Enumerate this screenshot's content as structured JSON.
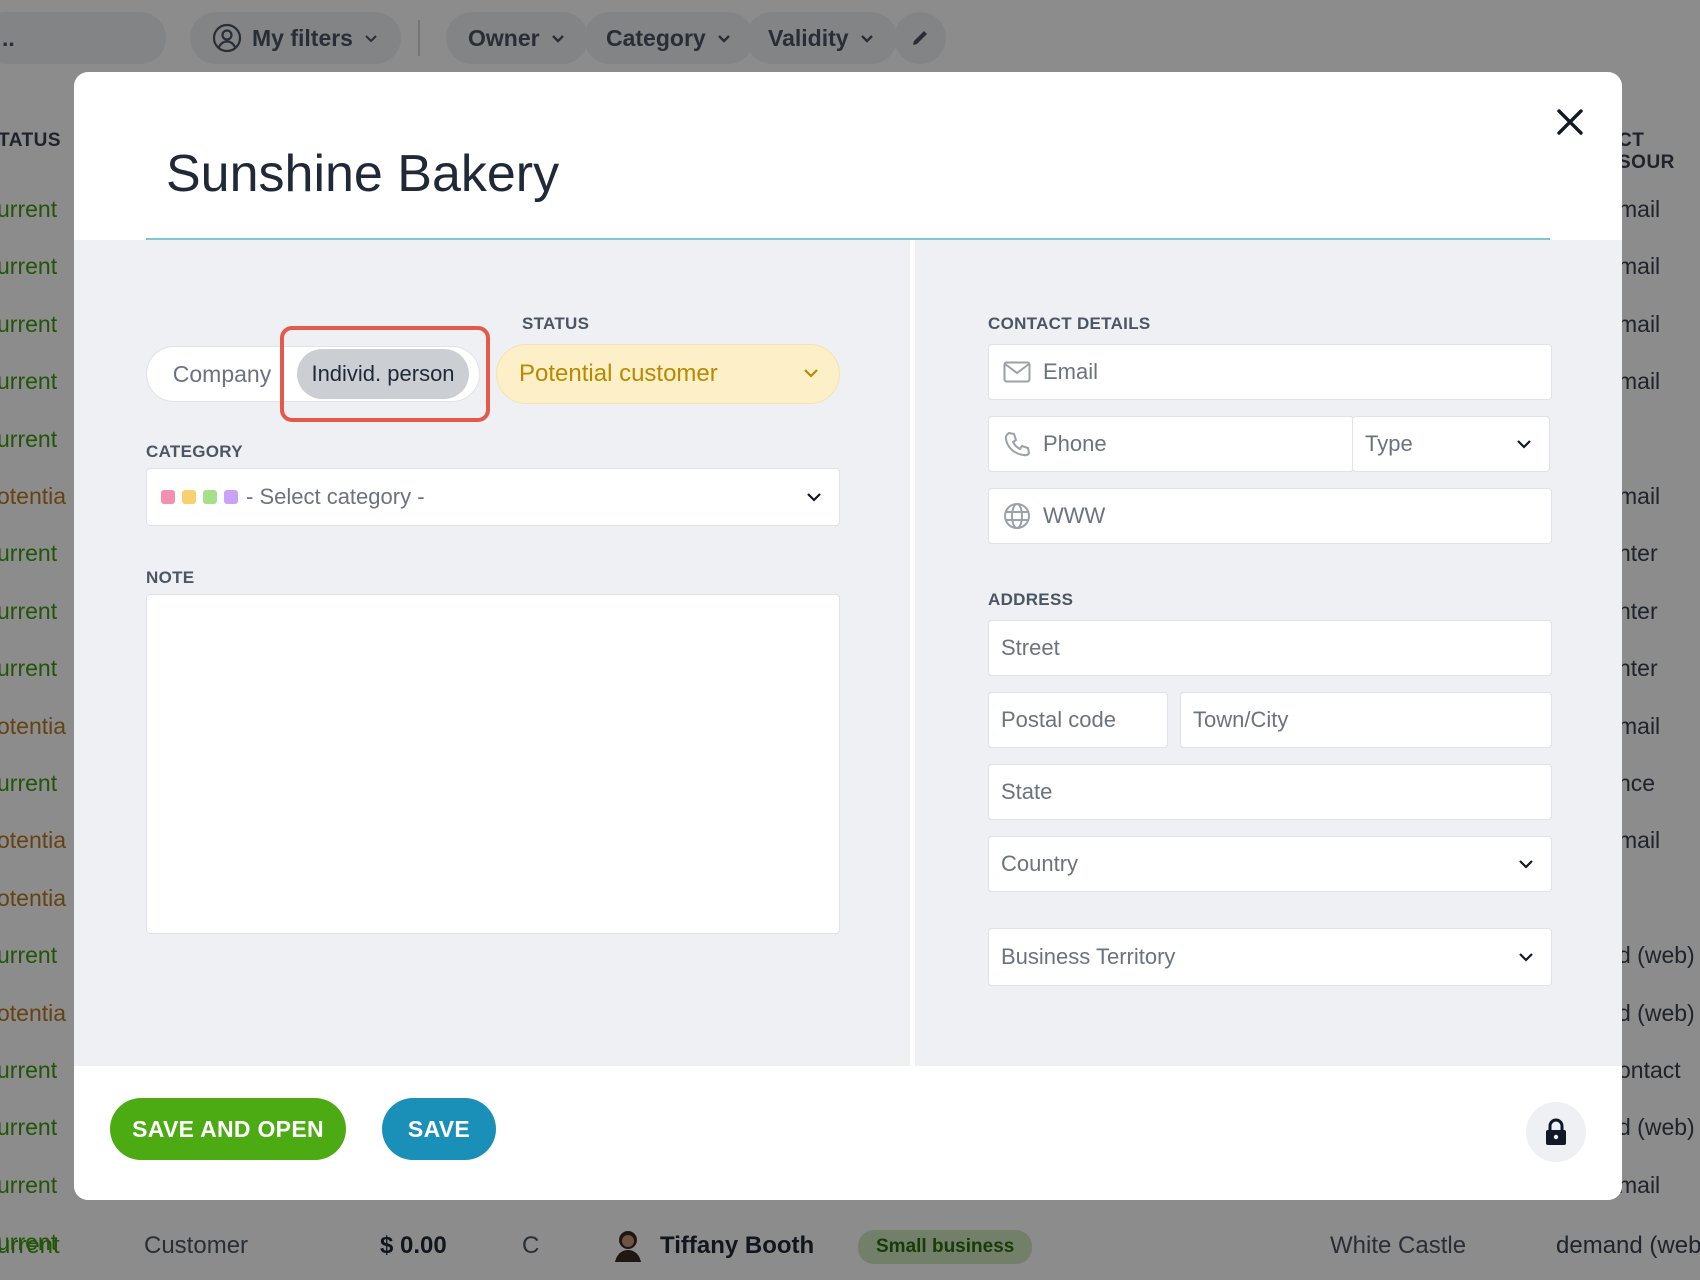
{
  "toolbar": {
    "search_placeholder": "..",
    "my_filters": "My filters",
    "owner": "Owner",
    "category": "Category",
    "validity": "Validity"
  },
  "background_table": {
    "col_status": "TATUS",
    "col_source": "CT SOUR",
    "status_rows": [
      "urrent",
      "urrent",
      "urrent",
      "urrent",
      "urrent",
      "otentia",
      "urrent",
      "urrent",
      "urrent",
      "otentia",
      "urrent",
      "otentia",
      "otentia",
      "urrent",
      "otentia",
      "urrent",
      "urrent",
      "urrent",
      "urrent"
    ],
    "source_rows": [
      "mail",
      "mail",
      "mail",
      "mail",
      "",
      "mail",
      "nter",
      "nter",
      "nter",
      "mail",
      "nce",
      "mail",
      "",
      "d (web)",
      "d (web)",
      "ontact",
      "d (web)",
      "mail",
      "demand (web)"
    ],
    "last_row": {
      "type": "Customer",
      "amount": "$ 0.00",
      "grade": "C",
      "name": "Tiffany Booth",
      "tag": "Small business",
      "city": "White Castle"
    }
  },
  "modal": {
    "title": "Sunshine Bakery",
    "type_toggle": {
      "company": "Company",
      "individual": "Individ. person",
      "selected": "individual"
    },
    "status_label": "STATUS",
    "status_value": "Potential customer",
    "category_label": "CATEGORY",
    "category_placeholder": "- Select category -",
    "category_dot_colors": [
      "#f48fb1",
      "#f7d070",
      "#a6e08b",
      "#c9a3f5"
    ],
    "note_label": "NOTE",
    "contact_label": "CONTACT DETAILS",
    "email_placeholder": "Email",
    "phone_placeholder": "Phone",
    "phone_type": "Type",
    "www_placeholder": "WWW",
    "address_label": "ADDRESS",
    "street_placeholder": "Street",
    "postal_placeholder": "Postal code",
    "town_placeholder": "Town/City",
    "state_placeholder": "State",
    "country_placeholder": "Country",
    "territory_placeholder": "Business Territory",
    "save_open_label": "SAVE AND OPEN",
    "save_label": "SAVE"
  },
  "colors": {
    "accent_green": "#4caa12",
    "accent_blue": "#1a8fb8",
    "status_fill": "#fdf0c8",
    "highlight_red": "#e45a4a"
  }
}
